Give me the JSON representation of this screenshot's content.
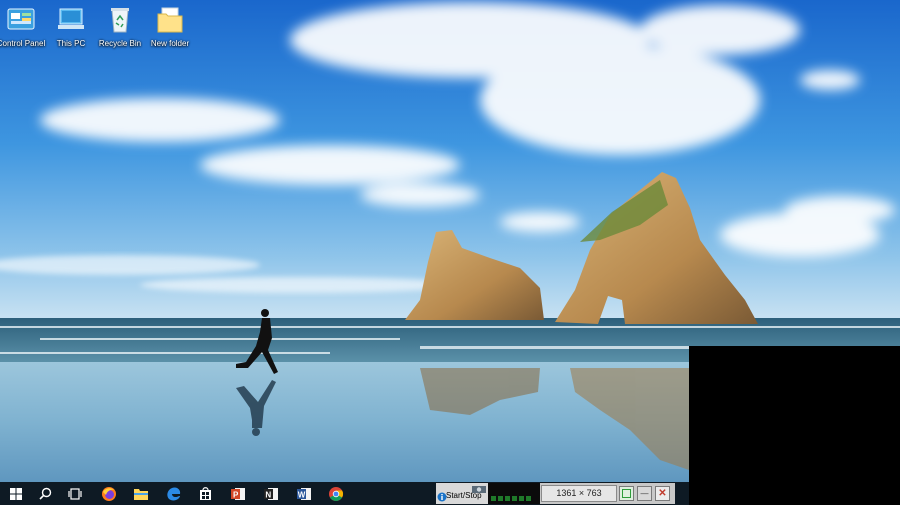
{
  "desktop_icons": [
    {
      "label": "Control Panel",
      "icon": "control-panel-icon"
    },
    {
      "label": "This PC",
      "icon": "this-pc-icon"
    },
    {
      "label": "Recycle Bin",
      "icon": "recycle-bin-icon"
    },
    {
      "label": "New folder",
      "icon": "folder-icon"
    }
  ],
  "taskbar": {
    "items": [
      {
        "name": "start",
        "icon": "windows-logo-icon"
      },
      {
        "name": "search",
        "icon": "search-icon"
      },
      {
        "name": "task-view",
        "icon": "task-view-icon"
      },
      {
        "name": "firefox",
        "icon": "firefox-icon"
      },
      {
        "name": "file-explorer",
        "icon": "file-explorer-icon"
      },
      {
        "name": "edge",
        "icon": "edge-icon"
      },
      {
        "name": "store",
        "icon": "store-icon"
      },
      {
        "name": "powerpoint",
        "icon": "powerpoint-icon"
      },
      {
        "name": "onenote",
        "icon": "onenote-icon"
      },
      {
        "name": "word",
        "icon": "word-icon"
      },
      {
        "name": "chrome",
        "icon": "chrome-icon"
      }
    ]
  },
  "recorder": {
    "start_stop_label": "Start/Stop",
    "capture_size": "1361 × 763",
    "minimize_symbol": "—",
    "close_symbol": "✕"
  },
  "colors": {
    "taskbar_bg": "#0e1a24",
    "sky_top": "#1e6fd0",
    "sea": "#2f6f8e",
    "recorder_close": "#c0392b",
    "recorder_green": "#2e9c3a"
  }
}
